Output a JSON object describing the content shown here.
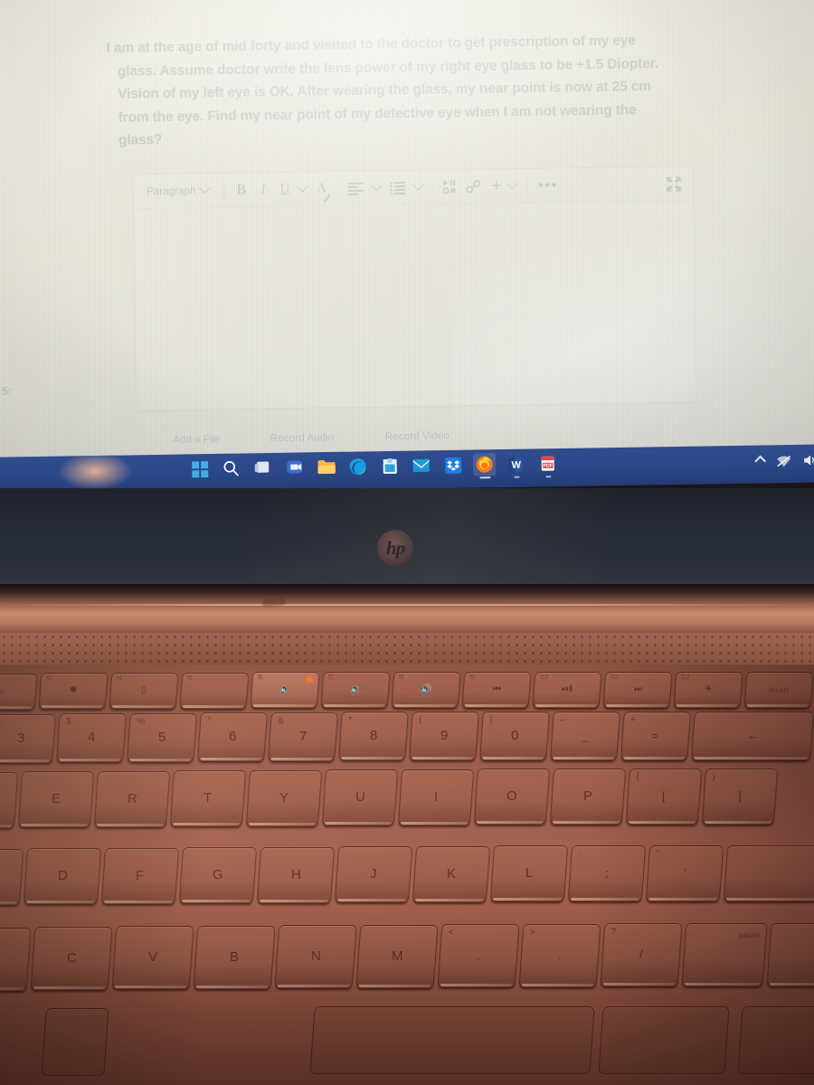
{
  "question": {
    "line1": "I am at the age of mid forty and visited to the doctor to get prescription of my eye",
    "line2": "glass. Assume doctor write the lens power of my right eye glass to be +1.5 Diopter.",
    "line3": "Vision of my left eye is OK. After wearing the glass, my near point is now at 25 cm",
    "line4": "from the eye. Find my near point of my defective eye when I am not wearing the",
    "line5": "glass?"
  },
  "left_margin_stub": "5:",
  "editor": {
    "toolbar": {
      "paragraph_label": "Paragraph",
      "bold_label": "B",
      "italic_label": "I",
      "underline_label": "U",
      "text_color_label": "A",
      "align_icon": "align-left-icon",
      "list_icon": "bulleted-list-icon",
      "media_icon": "media-player-icon",
      "link_icon": "link-icon",
      "plus_label": "+",
      "more_label": "•••",
      "fullscreen_icon": "fullscreen-icon"
    },
    "body_text": "",
    "body_placeholder": ""
  },
  "attachments": {
    "add_file": "Add a File",
    "record_audio": "Record Audio",
    "record_video": "Record Video"
  },
  "taskbar": {
    "items": [
      {
        "name": "start",
        "label": "Start"
      },
      {
        "name": "search",
        "label": "Search"
      },
      {
        "name": "task-view",
        "label": "Task View"
      },
      {
        "name": "chat",
        "label": "Chat"
      },
      {
        "name": "file-explorer",
        "label": "File Explorer"
      },
      {
        "name": "edge",
        "label": "Microsoft Edge"
      },
      {
        "name": "store",
        "label": "Microsoft Store"
      },
      {
        "name": "mail",
        "label": "Mail"
      },
      {
        "name": "dropbox",
        "label": "Dropbox"
      },
      {
        "name": "firefox",
        "label": "Firefox"
      },
      {
        "name": "word",
        "label": "W"
      },
      {
        "name": "pdf",
        "label": "PDF"
      }
    ],
    "tray": [
      {
        "name": "show-hidden-icons",
        "label": "^"
      },
      {
        "name": "network",
        "label": "Network"
      },
      {
        "name": "volume",
        "label": "Volume"
      }
    ]
  },
  "laptop": {
    "brand": "hp"
  },
  "keyboard": {
    "function_row": [
      {
        "name": "f3-brightness-up",
        "fn": "f3",
        "glyph": "☀"
      },
      {
        "name": "f4-display-switch",
        "fn": "f4",
        "glyph": "▭"
      },
      {
        "name": "f5-keyboard-backlight",
        "fn": "f5",
        "glyph": ""
      },
      {
        "name": "f6-mute",
        "fn": "f6",
        "glyph": "🔇",
        "led": true
      },
      {
        "name": "f7-volume-down",
        "fn": "f7",
        "glyph": "🔉"
      },
      {
        "name": "f8-volume-up",
        "fn": "f8",
        "glyph": "🔊"
      },
      {
        "name": "f9-previous-track",
        "fn": "f9",
        "glyph": "⏮"
      },
      {
        "name": "f10-play-pause",
        "fn": "f10",
        "glyph": "▶‖"
      },
      {
        "name": "f11-next-track",
        "fn": "f11",
        "glyph": "⏭"
      },
      {
        "name": "f12-airplane-mode",
        "fn": "f12",
        "glyph": "✈"
      },
      {
        "name": "insert",
        "fn": "",
        "glyph": "insert",
        "word": true
      }
    ],
    "number_row": [
      {
        "name": "key-3",
        "sub": "#",
        "label": "3"
      },
      {
        "name": "key-4",
        "sub": "$",
        "label": "4"
      },
      {
        "name": "key-5",
        "sub": "%",
        "label": "5"
      },
      {
        "name": "key-6",
        "sub": "^",
        "label": "6"
      },
      {
        "name": "key-7",
        "sub": "&",
        "label": "7"
      },
      {
        "name": "key-8",
        "sub": "*",
        "label": "8"
      },
      {
        "name": "key-9",
        "sub": "(",
        "label": "9"
      },
      {
        "name": "key-0",
        "sub": ")",
        "label": "0"
      },
      {
        "name": "key-minus",
        "sub": "–",
        "label": "_"
      },
      {
        "name": "key-equals",
        "sub": "+",
        "label": "="
      },
      {
        "name": "key-backspace",
        "sub": "",
        "label": "←"
      }
    ],
    "top_letter_row": [
      {
        "name": "key-e",
        "label": "E"
      },
      {
        "name": "key-r",
        "label": "R"
      },
      {
        "name": "key-t",
        "label": "T"
      },
      {
        "name": "key-y",
        "label": "Y"
      },
      {
        "name": "key-u",
        "label": "U"
      },
      {
        "name": "key-i",
        "label": "I"
      },
      {
        "name": "key-o",
        "label": "O"
      },
      {
        "name": "key-p",
        "label": "P"
      },
      {
        "name": "key-bracket-left",
        "sub": "{",
        "label": "["
      },
      {
        "name": "key-bracket-right",
        "sub": "}",
        "label": "]"
      }
    ],
    "home_row": [
      {
        "name": "key-d",
        "label": "D"
      },
      {
        "name": "key-f",
        "label": "F"
      },
      {
        "name": "key-g",
        "label": "G"
      },
      {
        "name": "key-h",
        "label": "H"
      },
      {
        "name": "key-j",
        "label": "J"
      },
      {
        "name": "key-k",
        "label": "K"
      },
      {
        "name": "key-l",
        "label": "L"
      },
      {
        "name": "key-semicolon",
        "sub": ":",
        "label": ";"
      },
      {
        "name": "key-quote",
        "sub": "\"",
        "label": "'"
      }
    ],
    "bottom_row": [
      {
        "name": "key-c",
        "label": "C"
      },
      {
        "name": "key-v",
        "label": "V"
      },
      {
        "name": "key-b",
        "label": "B"
      },
      {
        "name": "key-n",
        "label": "N"
      },
      {
        "name": "key-m",
        "label": "M"
      },
      {
        "name": "key-comma",
        "sub": "<",
        "label": ","
      },
      {
        "name": "key-period",
        "sub": ">",
        "label": "."
      },
      {
        "name": "key-slash",
        "sub": "?",
        "label": "/"
      },
      {
        "name": "key-pause",
        "label": "pause",
        "word": true
      }
    ]
  },
  "colors": {
    "taskbar_blue": "#2b4788",
    "screen_bg": "#e7e6dc",
    "text_ink": "#242838",
    "keyboard_body": "#a5604e",
    "bezel": "#262a33"
  }
}
